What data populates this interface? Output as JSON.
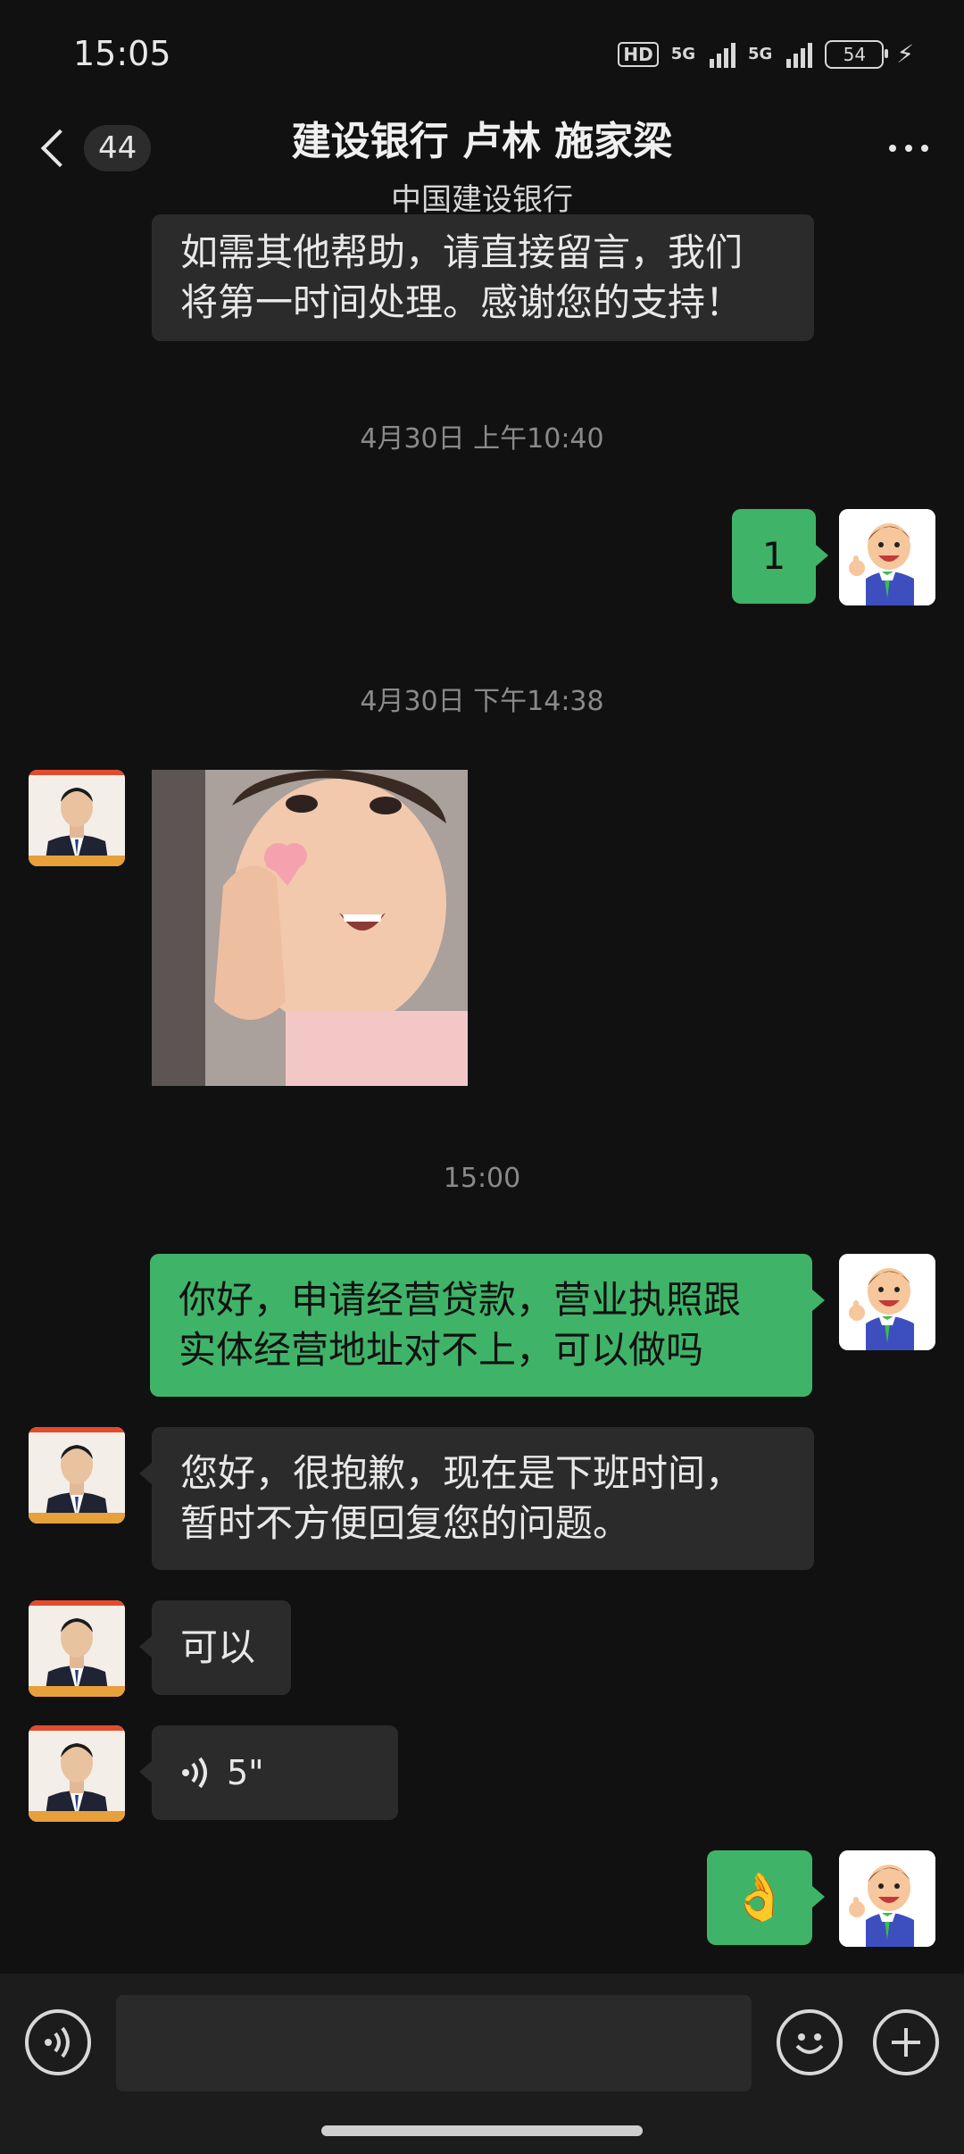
{
  "status_bar": {
    "time": "15:05",
    "hd": "HD",
    "net1": "5G",
    "net2": "5G",
    "battery": "54"
  },
  "header": {
    "unread_count": "44",
    "title": "建设银行 卢林 施家梁",
    "subtitle": "中国建设银行"
  },
  "messages": [
    {
      "type": "text",
      "direction": "in",
      "lines": [
        "如需其他帮助，请直接留言，我们",
        "将第一时间处理。感谢您的支持！"
      ]
    },
    {
      "type": "timestamp",
      "text": "4月30日 上午10:40"
    },
    {
      "type": "text",
      "direction": "out",
      "text": "1"
    },
    {
      "type": "timestamp",
      "text": "4月30日 下午14:38"
    },
    {
      "type": "image",
      "direction": "in",
      "content": "child making finger-heart gesture"
    },
    {
      "type": "timestamp",
      "text": "15:00"
    },
    {
      "type": "text",
      "direction": "out",
      "lines": [
        "你好，申请经营贷款，营业执照跟",
        "实体经营地址对不上，可以做吗"
      ]
    },
    {
      "type": "text",
      "direction": "in",
      "lines": [
        "您好，很抱歉，现在是下班时间，",
        "暂时不方便回复您的问题。"
      ]
    },
    {
      "type": "text",
      "direction": "in",
      "text": "可以"
    },
    {
      "type": "voice",
      "direction": "in",
      "duration": "5\""
    },
    {
      "type": "emoji",
      "direction": "out",
      "emoji": "👌"
    }
  ],
  "input_bar": {
    "placeholder": "",
    "icons": [
      "voice-input-icon",
      "emoji-icon",
      "plus-icon"
    ]
  },
  "colors": {
    "background": "#111111",
    "incoming_bubble": "#2b2b2b",
    "outgoing_bubble": "#3fb468",
    "timestamp": "#8a8a8a"
  }
}
